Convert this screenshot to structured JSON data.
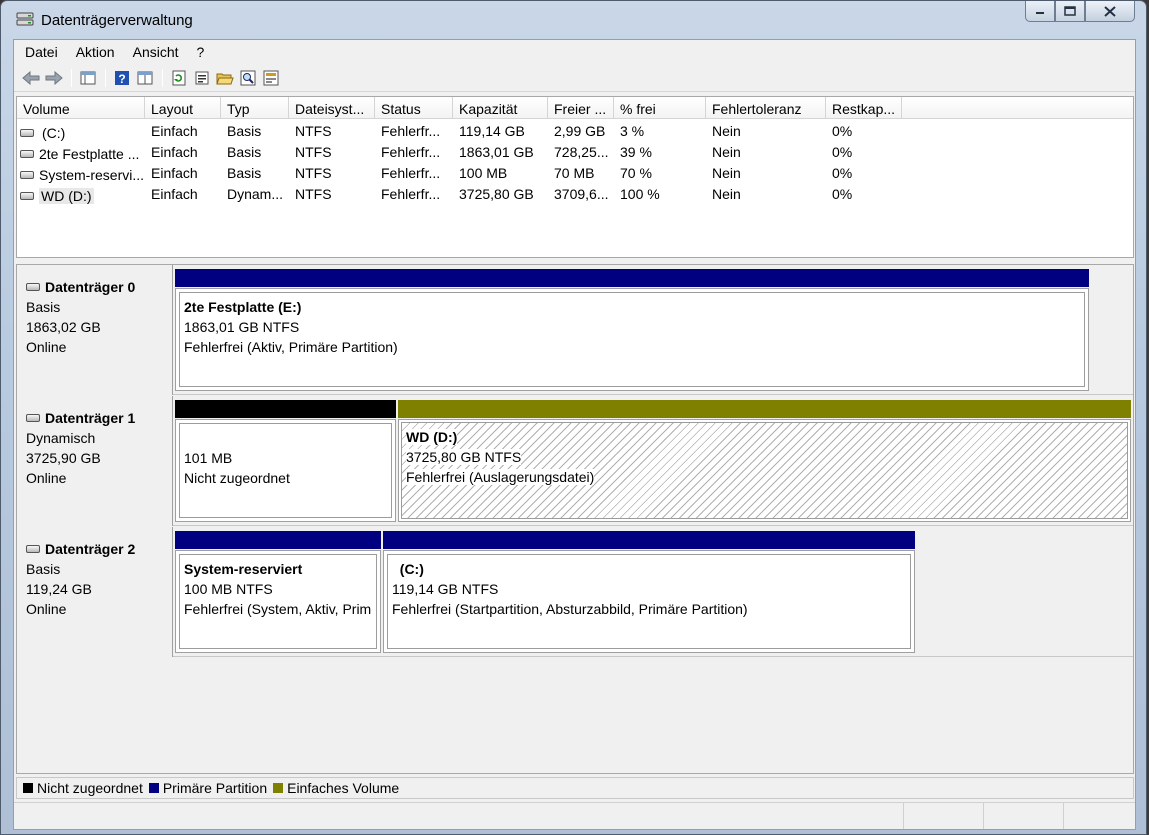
{
  "window": {
    "title": "Datenträgerverwaltung"
  },
  "menu": [
    "Datei",
    "Aktion",
    "Ansicht",
    "?"
  ],
  "toolbar": [
    "back-icon",
    "forward-icon",
    "console-tree-icon",
    "help-icon",
    "properties-view-icon",
    "refresh-icon",
    "properties-icon",
    "open-icon",
    "explore-icon",
    "settings-icon"
  ],
  "columns": [
    "Volume",
    "Layout",
    "Typ",
    "Dateisyst...",
    "Status",
    "Kapazität",
    "Freier ...",
    "% frei",
    "Fehlertoleranz",
    "Restkap..."
  ],
  "volumes": [
    {
      "volume": "(C:)",
      "layout": "Einfach",
      "typ": "Basis",
      "fs": "NTFS",
      "status": "Fehlerfr...",
      "capacity": "119,14 GB",
      "free": "2,99 GB",
      "pct": "3 %",
      "fault": "Nein",
      "overhead": "0%"
    },
    {
      "volume": "2te Festplatte ...",
      "layout": "Einfach",
      "typ": "Basis",
      "fs": "NTFS",
      "status": "Fehlerfr...",
      "capacity": "1863,01 GB",
      "free": "728,25...",
      "pct": "39 %",
      "fault": "Nein",
      "overhead": "0%"
    },
    {
      "volume": "System-reservi...",
      "layout": "Einfach",
      "typ": "Basis",
      "fs": "NTFS",
      "status": "Fehlerfr...",
      "capacity": "100 MB",
      "free": "70 MB",
      "pct": "70 %",
      "fault": "Nein",
      "overhead": "0%"
    },
    {
      "volume": "WD (D:)",
      "layout": "Einfach",
      "typ": "Dynam...",
      "fs": "NTFS",
      "status": "Fehlerfr...",
      "capacity": "3725,80 GB",
      "free": "3709,6...",
      "pct": "100 %",
      "fault": "Nein",
      "overhead": "0%"
    }
  ],
  "disks": [
    {
      "name": "Datenträger 0",
      "type": "Basis",
      "size": "1863,02 GB",
      "state": "Online",
      "partitions": [
        {
          "title": "2te Festplatte  (E:)",
          "line2": "1863,01 GB NTFS",
          "line3": "Fehlerfrei (Aktiv, Primäre Partition)",
          "bar": "#000080"
        }
      ]
    },
    {
      "name": "Datenträger 1",
      "type": "Dynamisch",
      "size": "3725,90 GB",
      "state": "Online",
      "partitions": [
        {
          "title": "",
          "line2": "101 MB",
          "line3": "Nicht zugeordnet",
          "bar": "#000000"
        },
        {
          "title": "WD  (D:)",
          "line2": "3725,80 GB NTFS",
          "line3": "Fehlerfrei (Auslagerungsdatei)",
          "bar": "#808000"
        }
      ]
    },
    {
      "name": "Datenträger 2",
      "type": "Basis",
      "size": "119,24 GB",
      "state": "Online",
      "partitions": [
        {
          "title": "System-reserviert",
          "line2": "100 MB NTFS",
          "line3": "Fehlerfrei (System, Aktiv, Prim",
          "bar": "#000080"
        },
        {
          "title": "  (C:)",
          "line2": "119,14 GB NTFS",
          "line3": "Fehlerfrei (Startpartition, Absturzabbild, Primäre Partition)",
          "bar": "#000080"
        }
      ]
    }
  ],
  "legend": [
    {
      "label": "Nicht zugeordnet",
      "color": "#000000"
    },
    {
      "label": "Primäre Partition",
      "color": "#000080"
    },
    {
      "label": "Einfaches Volume",
      "color": "#808000"
    }
  ]
}
